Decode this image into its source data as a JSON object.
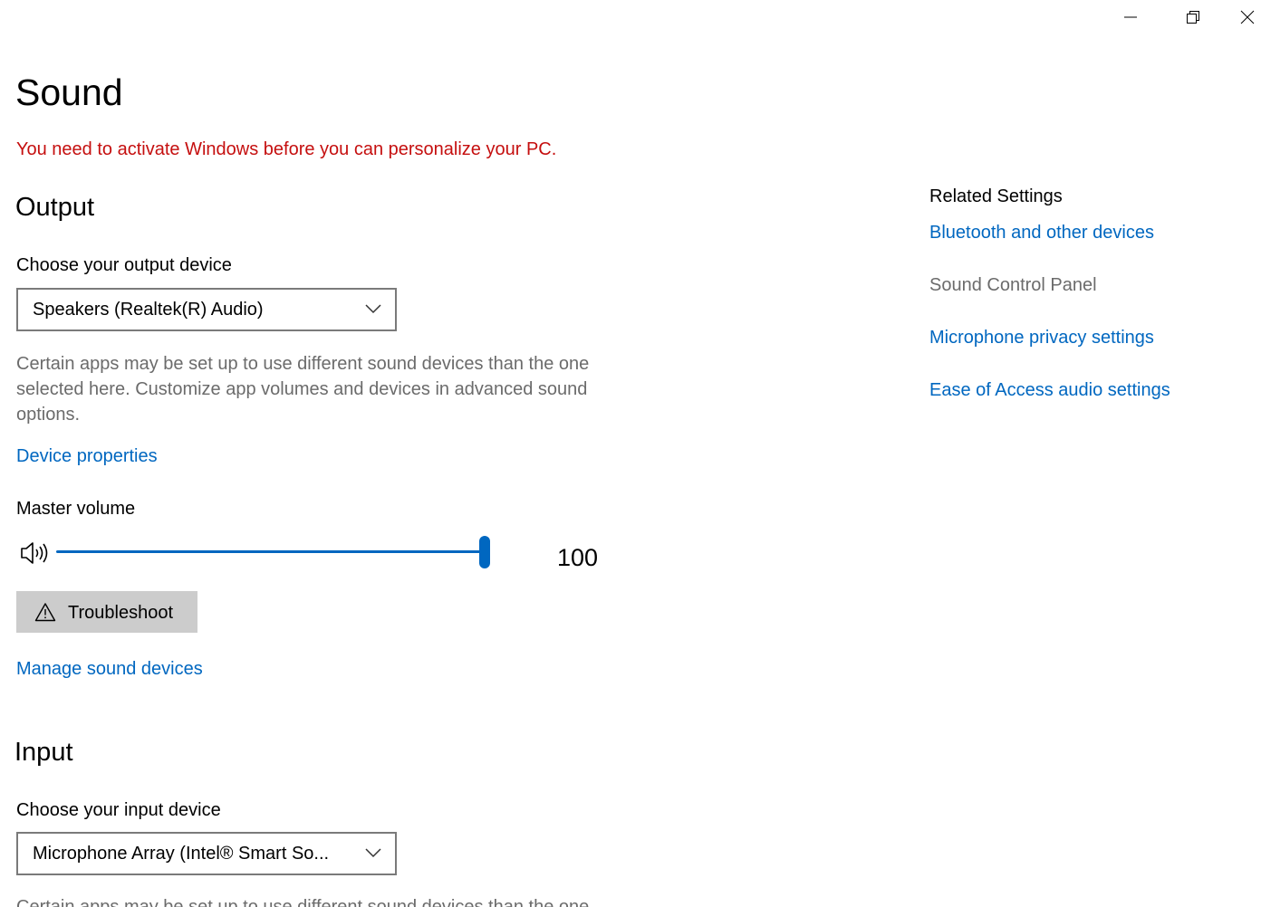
{
  "window_controls": {
    "minimize_icon": "minimize-icon",
    "restore_icon": "restore-icon",
    "close_icon": "close-icon"
  },
  "page": {
    "title": "Sound",
    "activation_notice": "You need to activate Windows before you can personalize your PC."
  },
  "output": {
    "heading": "Output",
    "device_label": "Choose your output device",
    "device_selected": "Speakers (Realtek(R) Audio)",
    "description": "Certain apps may be set up to use different sound devices than the one selected here. Customize app volumes and devices in advanced sound options.",
    "device_properties_link": "Device properties",
    "master_volume_label": "Master volume",
    "volume_icon": "speaker-icon",
    "master_volume_value": "100",
    "master_volume_level": 100,
    "troubleshoot_icon": "warning-icon",
    "troubleshoot_label": "Troubleshoot",
    "manage_devices_link": "Manage sound devices"
  },
  "input": {
    "heading": "Input",
    "device_label": "Choose your input device",
    "device_selected": "Microphone Array (Intel® Smart So...",
    "description_partial": "Certain apps may be set up to use different sound devices than the one"
  },
  "related_settings": {
    "title": "Related Settings",
    "links": [
      {
        "label": "Bluetooth and other devices",
        "enabled": true
      },
      {
        "label": "Sound Control Panel",
        "enabled": false
      },
      {
        "label": "Microphone privacy settings",
        "enabled": true
      },
      {
        "label": "Ease of Access audio settings",
        "enabled": true
      }
    ]
  },
  "colors": {
    "accent": "#0067c0",
    "warning_text": "#c50f0f",
    "secondary_text": "#6b6b6b",
    "button_bg": "#cccccc"
  }
}
